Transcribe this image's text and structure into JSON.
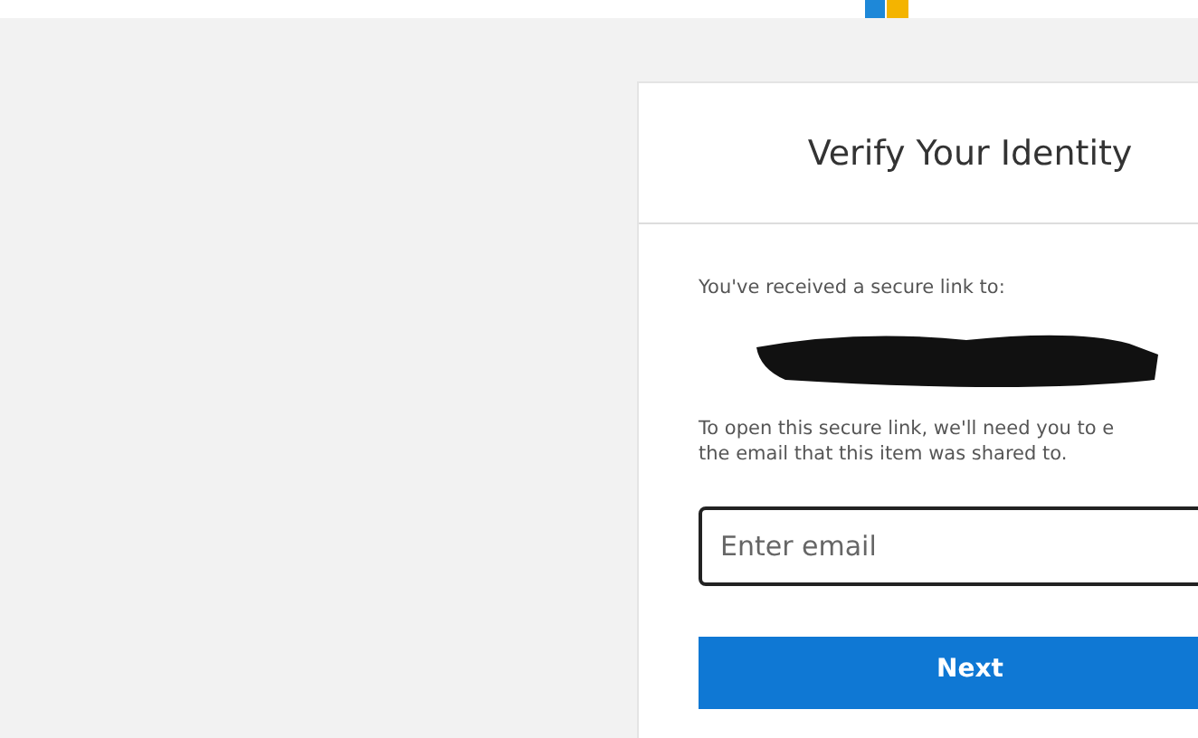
{
  "card": {
    "title": "Verify Your Identity",
    "intro": "You've received a secure link to:",
    "instructions": [
      "To open this secure link, we'll need you to e",
      "the email that this item was shared to."
    ],
    "email_field": {
      "placeholder": "Enter email"
    },
    "button": "Next"
  }
}
